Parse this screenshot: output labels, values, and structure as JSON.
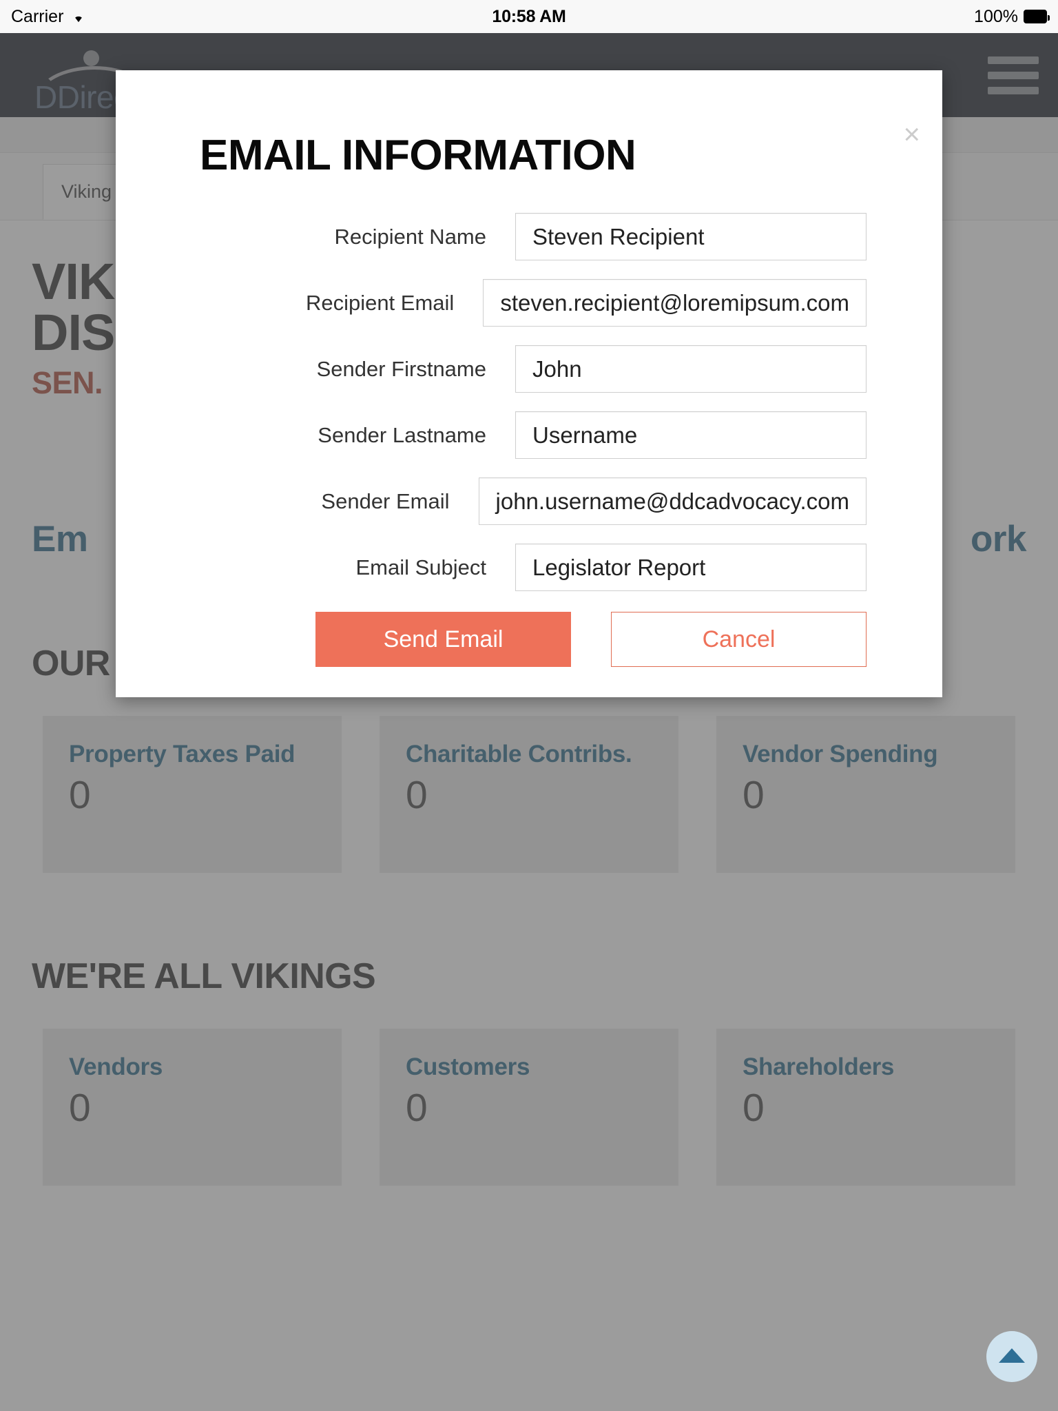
{
  "status_bar": {
    "carrier": "Carrier",
    "time": "10:58 AM",
    "battery": "100%",
    "wifi_icon": "wifi-icon",
    "battery_icon": "battery-full-icon"
  },
  "navbar": {
    "logo_text": "DDirec",
    "menu_icon": "hamburger-menu-icon"
  },
  "page": {
    "tab_label": "Viking",
    "hero_line1": "VIK",
    "hero_line2": "DIS",
    "hero_sub": "SEN.",
    "email_line_left": "Em",
    "email_line_right": "ork",
    "presence_section_title": "OUR PRESENCE IN YOUR DISTRICT",
    "vikings_section_title": "WE'RE ALL VIKINGS",
    "presence_cards": [
      {
        "title": "Property Taxes Paid",
        "value": "0"
      },
      {
        "title": "Charitable Contribs.",
        "value": "0"
      },
      {
        "title": "Vendor Spending",
        "value": "0"
      }
    ],
    "vikings_cards": [
      {
        "title": "Vendors",
        "value": "0"
      },
      {
        "title": "Customers",
        "value": "0"
      },
      {
        "title": "Shareholders",
        "value": "0"
      }
    ],
    "scroll_top_icon": "chevron-up-icon"
  },
  "modal": {
    "title": "EMAIL INFORMATION",
    "close_icon": "close-icon",
    "close_label": "×",
    "fields": [
      {
        "label": "Recipient Name",
        "value": "Steven Recipient",
        "name": "recipient-name-input"
      },
      {
        "label": "Recipient Email",
        "value": "steven.recipient@loremipsum.com",
        "name": "recipient-email-input"
      },
      {
        "label": "Sender Firstname",
        "value": "John",
        "name": "sender-firstname-input"
      },
      {
        "label": "Sender Lastname",
        "value": "Username",
        "name": "sender-lastname-input"
      },
      {
        "label": "Sender Email",
        "value": "john.username@ddcadvocacy.com",
        "name": "sender-email-input"
      },
      {
        "label": "Email Subject",
        "value": "Legislator Report",
        "name": "email-subject-input"
      }
    ],
    "send_label": "Send Email",
    "cancel_label": "Cancel"
  },
  "colors": {
    "accent": "#ee7159",
    "navbar": "#131a24",
    "card_title": "#1b5f80",
    "hero_sub": "#a8412f",
    "link": "#1f5d7f"
  }
}
